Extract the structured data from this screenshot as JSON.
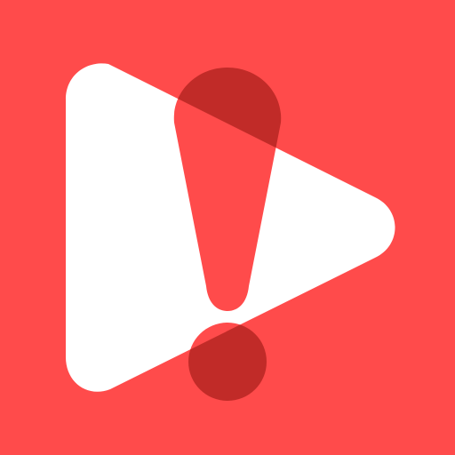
{
  "icon": {
    "name": "play-alert-app-icon",
    "colors": {
      "background": "#FF4B4B",
      "play_triangle": "#FFFFFF",
      "exclamation_on_white": "#FF4B4B",
      "exclamation_overlap": "#C12B28"
    },
    "glyphs": [
      "play-icon",
      "exclamation-icon"
    ]
  }
}
